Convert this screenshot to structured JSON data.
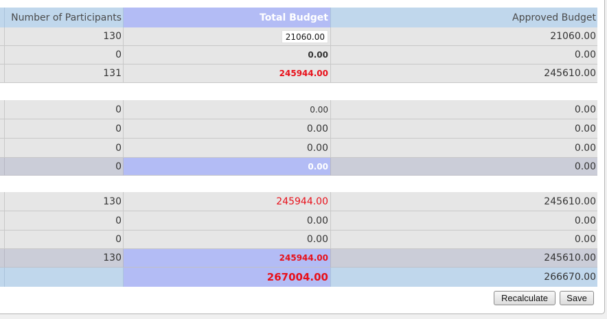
{
  "header": {
    "col_participants": "Number of Participants",
    "col_total": "Total Budget",
    "col_approved": "Approved Budget"
  },
  "section1": [
    {
      "participants": "130",
      "total": "21060.00",
      "approved": "21060.00"
    },
    {
      "participants": "0",
      "total": "0.00",
      "approved": "0.00"
    },
    {
      "participants": "131",
      "total": "245944.00",
      "approved": "245610.00"
    }
  ],
  "section2": [
    {
      "participants": "0",
      "total": "0.00",
      "approved": "0.00"
    },
    {
      "participants": "0",
      "total": "0.00",
      "approved": "0.00"
    },
    {
      "participants": "0",
      "total": "0.00",
      "approved": "0.00"
    }
  ],
  "section2_subtotal": {
    "participants": "0",
    "total": "0.00",
    "approved": "0.00"
  },
  "section3": [
    {
      "participants": "130",
      "total": "245944.00",
      "approved": "245610.00"
    },
    {
      "participants": "0",
      "total": "0.00",
      "approved": "0.00"
    },
    {
      "participants": "0",
      "total": "0.00",
      "approved": "0.00"
    }
  ],
  "section3_subtotal": {
    "participants": "130",
    "total": "245944.00",
    "approved": "245610.00"
  },
  "grand_total": {
    "total": "267004.00",
    "approved": "266670.00"
  },
  "buttons": {
    "recalculate": "Recalculate",
    "save": "Save"
  },
  "colors": {
    "header_bg": "#c0d7ec",
    "total_budget_bg": "#b3bcf5",
    "row_bg": "#e6e6e6",
    "subtotal_bg": "#cbcdd8",
    "alert_red": "#e8101a"
  }
}
